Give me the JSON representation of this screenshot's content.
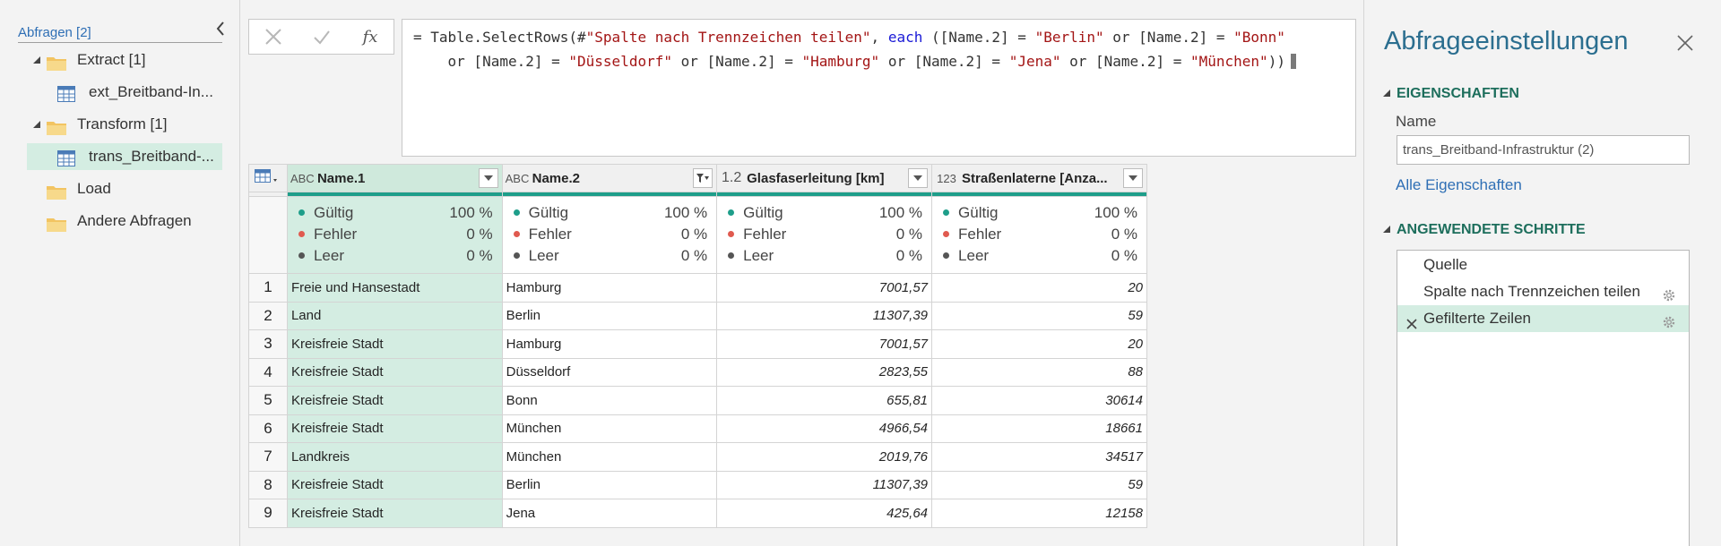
{
  "queries": {
    "header": "Abfragen [2]",
    "groups": [
      {
        "label": "Extract [1]",
        "item": "ext_Breitband-In..."
      },
      {
        "label": "Transform [1]",
        "item": "trans_Breitband-..."
      },
      {
        "label": "Load"
      },
      {
        "label": "Andere Abfragen"
      }
    ]
  },
  "formula_bar": {
    "fx_label": "fx",
    "line1_prefix": "= Table.SelectRows(#",
    "line1_str1": "\"Spalte nach Trennzeichen teilen\"",
    "line1_mid": ", ",
    "keyword": "each",
    "line1_cond_a": " ([Name.2] = ",
    "line1_str2": "\"Berlin\"",
    "line1_or1": " or [Name.2] = ",
    "line1_str3": "\"Bonn\"",
    "line2_prefix": "    or [Name.2] = ",
    "line2_str1": "\"Düsseldorf\"",
    "line2_or1": " or [Name.2] = ",
    "line2_str2": "\"Hamburg\"",
    "line2_or2": " or [Name.2] = ",
    "line2_str3": "\"Jena\"",
    "line2_or3": " or [Name.2] = ",
    "line2_str4": "\"München\"",
    "line2_end": "))"
  },
  "grid": {
    "columns": [
      {
        "type_icon": "ABC",
        "name": "Name.1"
      },
      {
        "type_icon": "ABC",
        "name": "Name.2"
      },
      {
        "type_icon": "1.2",
        "name": "Glasfaserleitung [km]"
      },
      {
        "type_icon": "123",
        "name": "Straßenlaterne [Anza..."
      }
    ],
    "stats": {
      "valid_label": "Gültig",
      "valid_pct": "100 %",
      "error_label": "Fehler",
      "error_pct": "0 %",
      "empty_label": "Leer",
      "empty_pct": "0 %"
    },
    "rows": [
      [
        "1",
        "Freie und Hansestadt",
        "Hamburg",
        "7001,57",
        "20"
      ],
      [
        "2",
        "Land",
        "Berlin",
        "11307,39",
        "59"
      ],
      [
        "3",
        "Kreisfreie Stadt",
        "Hamburg",
        "7001,57",
        "20"
      ],
      [
        "4",
        "Kreisfreie Stadt",
        "Düsseldorf",
        "2823,55",
        "88"
      ],
      [
        "5",
        "Kreisfreie Stadt",
        "Bonn",
        "655,81",
        "30614"
      ],
      [
        "6",
        "Kreisfreie Stadt",
        "München",
        "4966,54",
        "18661"
      ],
      [
        "7",
        "Landkreis",
        "München",
        "2019,76",
        "34517"
      ],
      [
        "8",
        "Kreisfreie Stadt",
        "Berlin",
        "11307,39",
        "59"
      ],
      [
        "9",
        "Kreisfreie Stadt",
        "Jena",
        "425,64",
        "12158"
      ]
    ]
  },
  "settings": {
    "title": "Abfrageeinstellungen",
    "properties_header": "EIGENSCHAFTEN",
    "name_label": "Name",
    "name_value": "trans_Breitband-Infrastruktur (2)",
    "all_properties": "Alle Eigenschaften",
    "steps_header": "ANGEWENDETE SCHRITTE",
    "steps": [
      "Quelle",
      "Spalte nach Trennzeichen teilen",
      "Gefilterte Zeilen"
    ]
  },
  "colors": {
    "accent_green": "#1d6e5c",
    "selection": "#d4ede2",
    "quality_bar": "#1e9e8a",
    "valid_dot": "#1e9e8a",
    "error_dot": "#e05a4f",
    "empty_dot": "#555555",
    "link_blue": "#2f6fb5"
  }
}
